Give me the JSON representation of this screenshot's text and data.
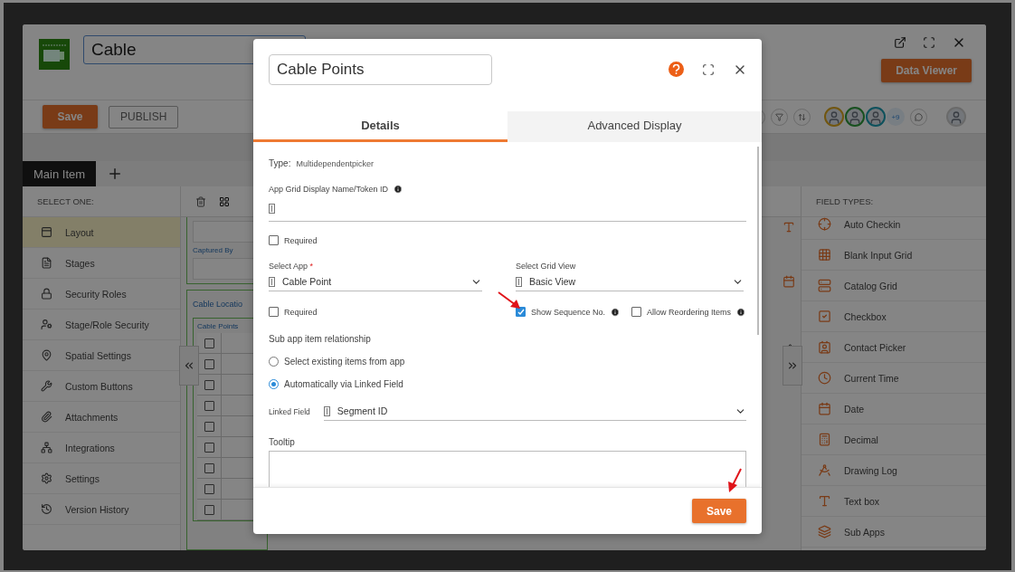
{
  "app": {
    "title": "Cable",
    "data_viewer": "Data Viewer",
    "save": "Save",
    "publish": "PUBLISH",
    "more_users": "+9",
    "tab": "Main Item"
  },
  "sidebar": {
    "heading": "SELECT ONE:",
    "items": [
      {
        "label": "Layout",
        "selected": true
      },
      {
        "label": "Stages",
        "selected": false
      },
      {
        "label": "Security Roles",
        "selected": false
      },
      {
        "label": "Stage/Role Security",
        "selected": false
      },
      {
        "label": "Spatial Settings",
        "selected": false
      },
      {
        "label": "Custom Buttons",
        "selected": false
      },
      {
        "label": "Attachments",
        "selected": false
      },
      {
        "label": "Integrations",
        "selected": false
      },
      {
        "label": "Settings",
        "selected": false
      },
      {
        "label": "Version History",
        "selected": false
      }
    ]
  },
  "canvas": {
    "captured_by": "Captured By",
    "section": "Cable Locatio",
    "grid": "Cable Points",
    "rows": [
      {
        "checked": false
      },
      {
        "checked": false
      },
      {
        "checked": false
      },
      {
        "checked": false
      },
      {
        "checked": false
      },
      {
        "checked": false
      },
      {
        "checked": false
      },
      {
        "checked": false
      },
      {
        "checked": false
      }
    ]
  },
  "field_types": {
    "heading": "FIELD TYPES:",
    "items": [
      "Auto Checkin",
      "Blank Input Grid",
      "Catalog Grid",
      "Checkbox",
      "Contact Picker",
      "Current Time",
      "Date",
      "Decimal",
      "Drawing Log",
      "Text box",
      "Sub Apps"
    ]
  },
  "dialog": {
    "title": "Cable Points",
    "tabs": [
      {
        "label": "Details",
        "selected": true
      },
      {
        "label": "Advanced Display",
        "selected": false
      }
    ],
    "type_label": "Type:",
    "type_value": "Multidependentpicker",
    "display_name_label": "App Grid Display Name/Token ID",
    "required": {
      "label": "Required",
      "checked": false
    },
    "select_app": {
      "label": "Select App",
      "mark": "*",
      "value": "Cable Point"
    },
    "grid_view": {
      "label": "Select Grid View",
      "value": "Basic View"
    },
    "options": [
      {
        "label": "Required",
        "checked": false,
        "info": false
      },
      {
        "label": "Show Sequence No.",
        "checked": true,
        "info": true
      },
      {
        "label": "Allow Reordering Items",
        "checked": false,
        "info": true
      }
    ],
    "relationship": {
      "label": "Sub app item relationship",
      "choices": [
        {
          "label": "Select existing items from app",
          "selected": false
        },
        {
          "label": "Automatically via Linked Field",
          "selected": true
        }
      ]
    },
    "linked_field": {
      "label": "Linked Field",
      "value": "Segment ID"
    },
    "tooltip_label": "Tooltip",
    "save": "Save"
  }
}
